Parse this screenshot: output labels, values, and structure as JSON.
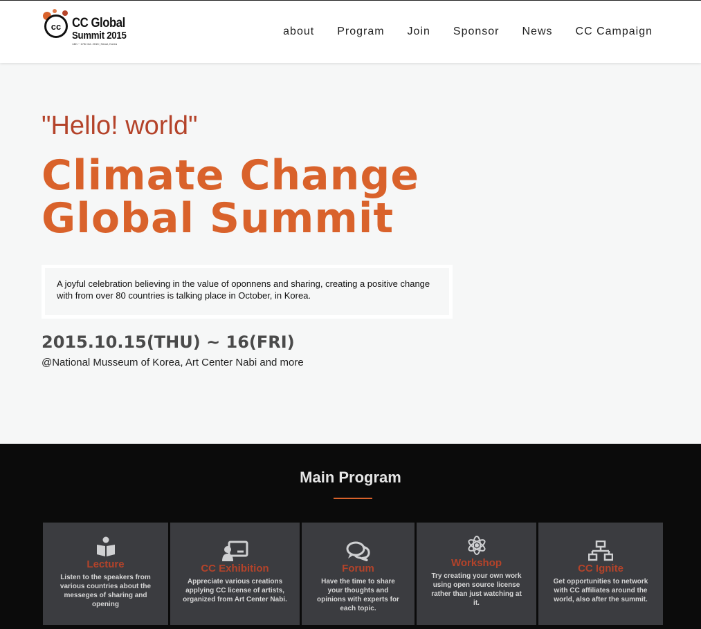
{
  "header": {
    "logo": {
      "mark": "cc",
      "line1": "CC Global",
      "line2": "Summit 2015",
      "line3": "14th ~ 17th Oct. 2015 | Seoul, Korea"
    },
    "nav": [
      "about",
      "Program",
      "Join",
      "Sponsor",
      "News",
      "CC Campaign"
    ]
  },
  "hero": {
    "tagline": "\"Hello! world\"",
    "title_line1": "Climate Change",
    "title_line2": "Global Summit",
    "description": "A joyful celebration believing in the value of oponnens and sharing, creating a positive change with from over 80 countries is talking place in October, in Korea.",
    "date": "2015.10.15(THU) ~ 16(FRI)",
    "venue": "@National Musseum of Korea, Art Center Nabi and more"
  },
  "program": {
    "title": "Main Program",
    "cards": [
      {
        "icon": "book-icon",
        "title": "Lecture",
        "text": "Listen to the speakers from various countries about the messeges of sharing and opening"
      },
      {
        "icon": "presenter-icon",
        "title": "CC Exhibition",
        "text": "Appreciate various creations applying CC license of artists, organized from Art Center Nabi."
      },
      {
        "icon": "chat-icon",
        "title": "Forum",
        "text": "Have the time to share your thoughts and opinions with experts for each topic."
      },
      {
        "icon": "atom-icon",
        "title": "Workshop",
        "text": "Try creating your own work using open source license rather than just watching at it."
      },
      {
        "icon": "network-icon",
        "title": "CC Ignite",
        "text": "Get opportunities to network with CC affiliates around the world, also after the summit."
      }
    ]
  },
  "colors": {
    "accent": "#d9622b",
    "accent_dark": "#b4432a",
    "card_bg": "#3b3c40",
    "program_bg": "#0b0b0b"
  }
}
